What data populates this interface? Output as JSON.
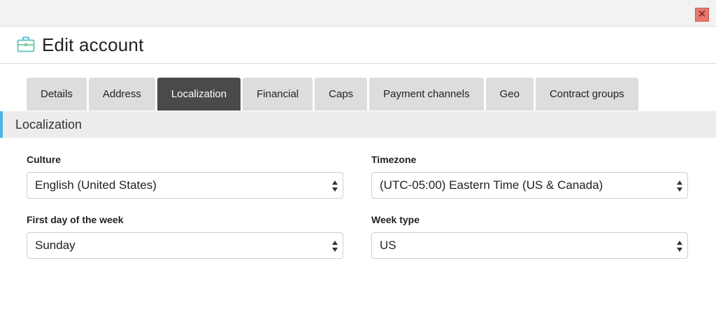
{
  "window": {
    "close_label": "✕"
  },
  "header": {
    "title": "Edit account",
    "icon": "briefcase-icon",
    "icon_colors": [
      "#5bc0de",
      "#7ed09a"
    ]
  },
  "tabs": [
    {
      "label": "Details",
      "active": false
    },
    {
      "label": "Address",
      "active": false
    },
    {
      "label": "Localization",
      "active": true
    },
    {
      "label": "Financial",
      "active": false
    },
    {
      "label": "Caps",
      "active": false
    },
    {
      "label": "Payment channels",
      "active": false
    },
    {
      "label": "Geo",
      "active": false
    },
    {
      "label": "Contract groups",
      "active": false
    }
  ],
  "section": {
    "title": "Localization",
    "accent": "#4fb3e6"
  },
  "form": {
    "culture": {
      "label": "Culture",
      "value": "English (United States)"
    },
    "timezone": {
      "label": "Timezone",
      "value": "(UTC-05:00) Eastern Time (US & Canada)"
    },
    "first_day": {
      "label": "First day of the week",
      "value": "Sunday"
    },
    "week_type": {
      "label": "Week type",
      "value": "US"
    }
  }
}
